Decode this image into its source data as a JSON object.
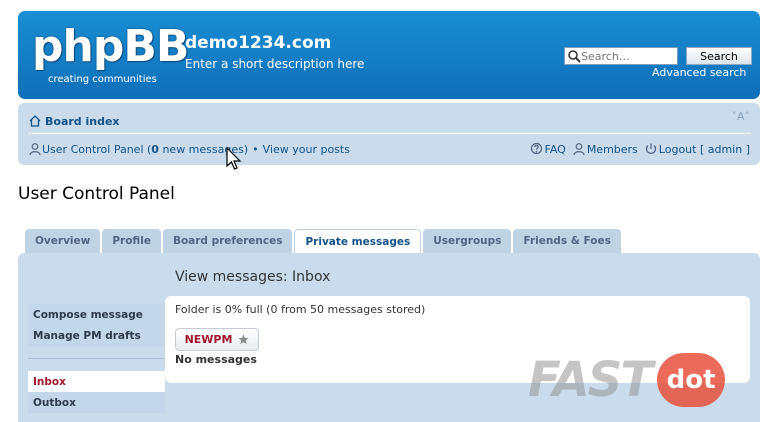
{
  "header": {
    "logo_text": "phpBB",
    "logo_tagline": "creating communities",
    "site_title": "demo1234.com",
    "site_description": "Enter a short description here",
    "search_placeholder": "Search…",
    "search_button": "Search",
    "advanced_search": "Advanced search"
  },
  "navbar": {
    "board_index": "Board index",
    "font_size_control": "˅A˄",
    "ucp_link_prefix": "User Control Panel (",
    "new_message_count": "0",
    "ucp_link_suffix": " new messages)",
    "separator": "•",
    "view_posts": "View your posts",
    "faq": "FAQ",
    "members": "Members",
    "logout": "Logout [ admin ]"
  },
  "page_title": "User Control Panel",
  "tabs": [
    {
      "label": "Overview",
      "active": false
    },
    {
      "label": "Profile",
      "active": false
    },
    {
      "label": "Board preferences",
      "active": false
    },
    {
      "label": "Private messages",
      "active": true
    },
    {
      "label": "Usergroups",
      "active": false
    },
    {
      "label": "Friends & Foes",
      "active": false
    }
  ],
  "panel": {
    "view_title": "View messages: Inbox",
    "side_menu_top": [
      "Compose message",
      "Manage PM drafts"
    ],
    "side_menu_bottom": [
      "Inbox",
      "Outbox"
    ],
    "folder_status": "Folder is 0% full (0 from 50 messages stored)",
    "new_pm_button": "NEWPM",
    "no_messages": "No messages"
  },
  "watermark": {
    "left": "FAST",
    "right": "dot"
  },
  "colors": {
    "header": "#1a8ed4",
    "navbar": "#cadceb",
    "link": "#105289",
    "active_item": "#a3152c"
  }
}
